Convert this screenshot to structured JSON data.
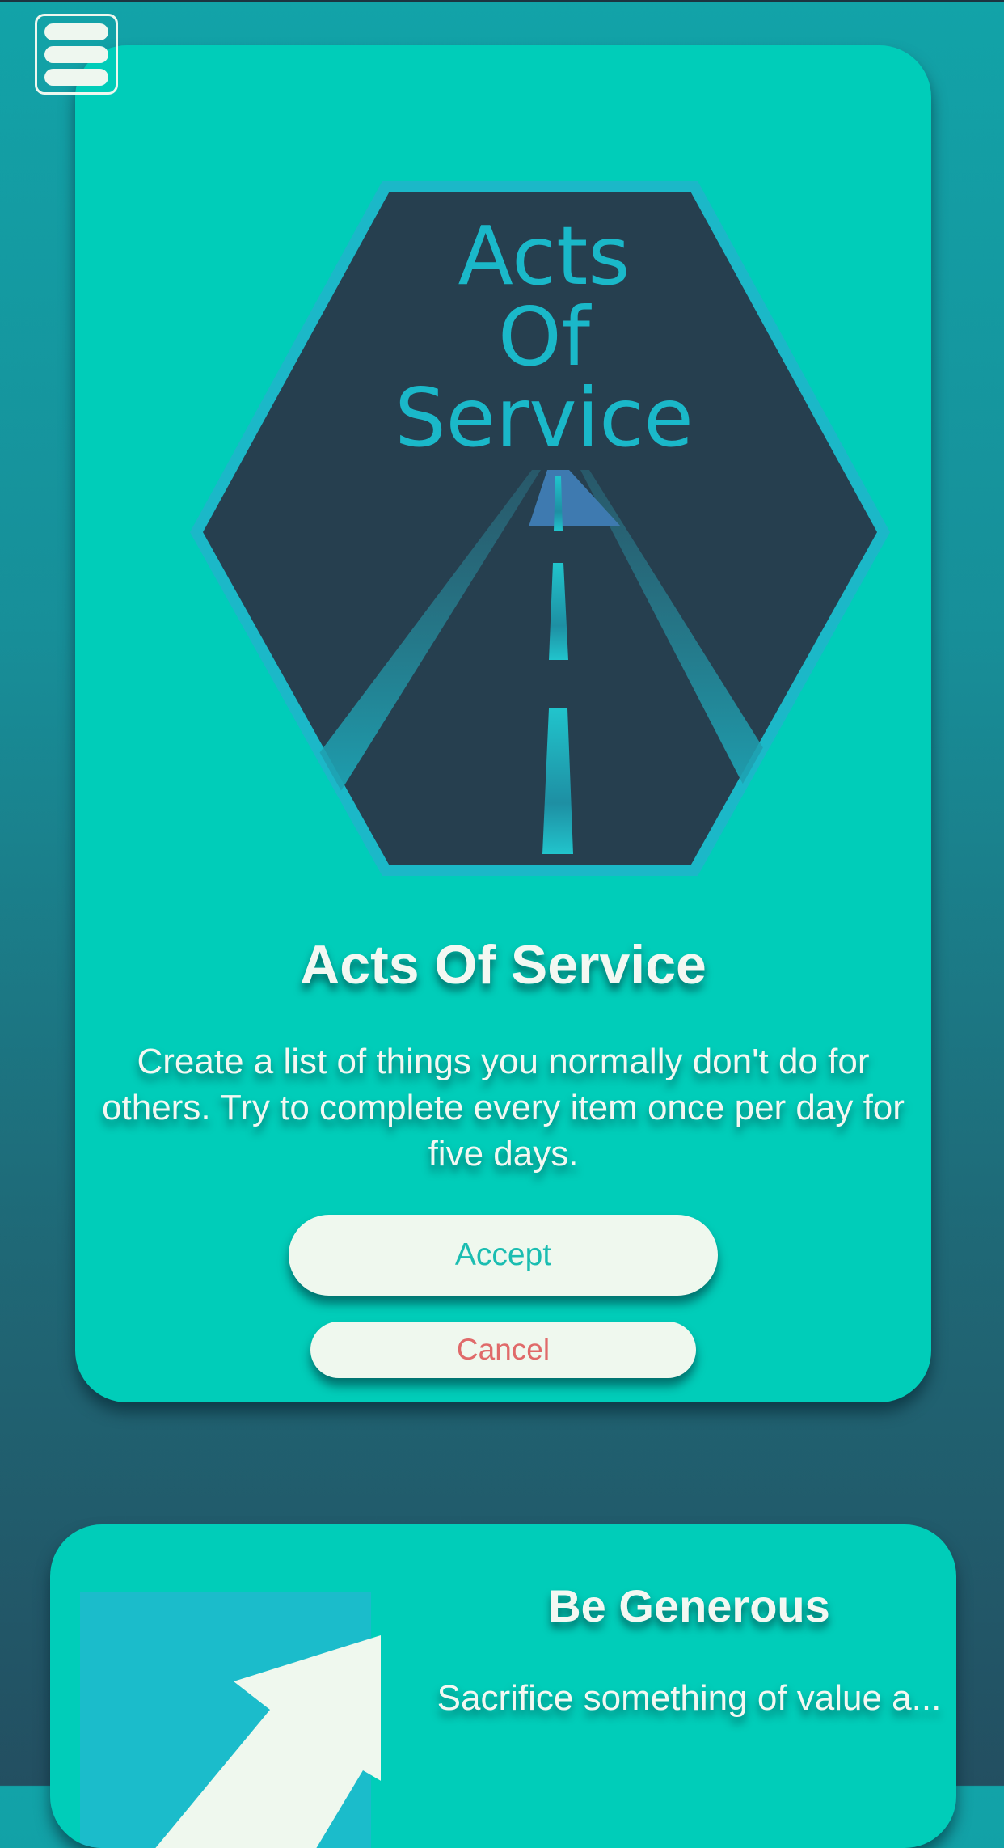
{
  "menu": {
    "icon": "hamburger-menu-icon"
  },
  "challenges": [
    {
      "emblem": {
        "lines": [
          "Acts",
          "Of",
          "Service"
        ],
        "icon": "road-hexagon-icon"
      },
      "title": "Acts Of Service",
      "description": "Create a list of things you normally don't do for others. Try to complete every item once per day for five days.",
      "accept_label": "Accept",
      "cancel_label": "Cancel"
    },
    {
      "icon": "rising-arrow-icon",
      "title": "Be Generous",
      "description": "Sacrifice something of value a..."
    }
  ],
  "colors": {
    "card": "#00cdb9",
    "hexagon": "#263f4f",
    "hexagon_border": "#1bb8c8",
    "emblem_text": "#1ab8c9",
    "button_bg": "#eff8ee",
    "accept_text": "#1bbdb1",
    "cancel_text": "#e06a6a",
    "text_light": "#f3f8f2"
  }
}
